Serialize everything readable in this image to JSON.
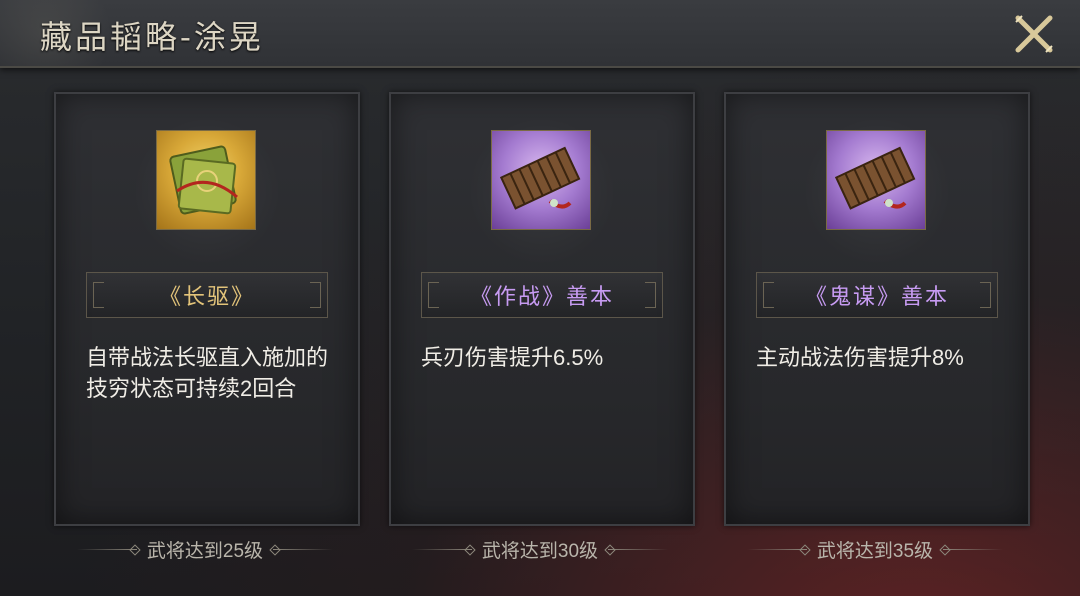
{
  "header": {
    "title": "藏品韬略-涂晃"
  },
  "cards": [
    {
      "icon": "book-bundle-gold-icon",
      "name": "《长驱》",
      "quality_color": "#e3c47a",
      "description": "自带战法长驱直入施加的技穷状态可持续2回合",
      "requirement": "武将达到25级"
    },
    {
      "icon": "bamboo-scroll-purple-icon",
      "name": "《作战》善本",
      "quality_color": "#c79bf2",
      "description": "兵刃伤害提升6.5%",
      "requirement": "武将达到30级"
    },
    {
      "icon": "bamboo-scroll-purple-icon",
      "name": "《鬼谋》善本",
      "quality_color": "#c79bf2",
      "description": "主动战法伤害提升8%",
      "requirement": "武将达到35级"
    }
  ]
}
